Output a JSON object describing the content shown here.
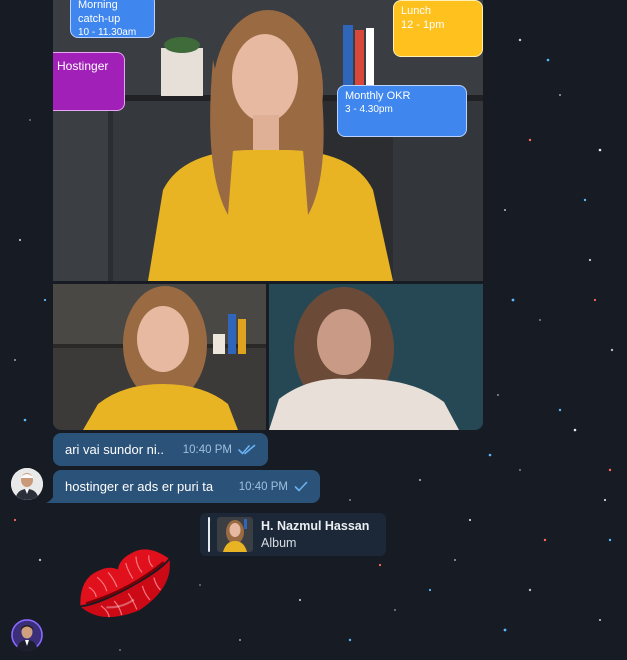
{
  "album": {
    "calendar_cards": [
      {
        "title": "Morning catch-up",
        "time": "10 - 11.30am"
      },
      {
        "title": "n Hostinger",
        "time": ""
      },
      {
        "title": "Lunch",
        "time": "12 - 1pm"
      },
      {
        "title": "Monthly OKR",
        "time": "3 - 4.30pm"
      }
    ]
  },
  "messages": [
    {
      "text": "ari vai sundor ni..",
      "time": "10:40 PM",
      "status": "read-double-check"
    },
    {
      "text": "hostinger er ads er puri ta",
      "time": "10:40 PM",
      "status": "sent-single-check"
    }
  ],
  "reply": {
    "name": "H. Nazmul Hassan",
    "subtitle": "Album"
  },
  "sticker": {
    "icon": "red-lips-kiss"
  },
  "colors": {
    "background": "#171c24",
    "bubble": "#2b5278",
    "check": "#6ab2f2",
    "card_blue": "#3f86ee",
    "card_purple": "#a020b8",
    "card_yellow": "#ffc11d"
  }
}
